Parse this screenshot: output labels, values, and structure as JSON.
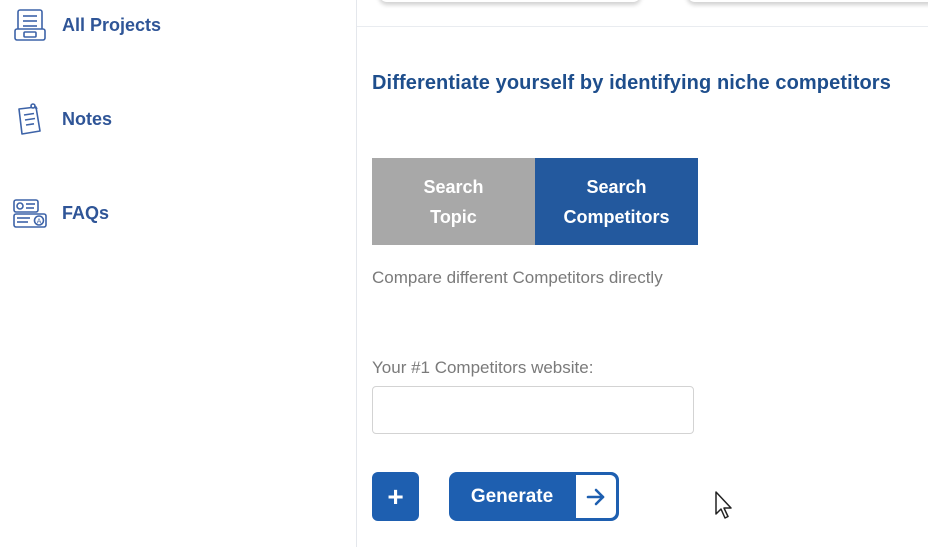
{
  "sidebar": {
    "items": [
      {
        "label": "All Projects",
        "icon": "projects-icon"
      },
      {
        "label": "Notes",
        "icon": "notes-icon"
      },
      {
        "label": "FAQs",
        "icon": "faq-icon"
      }
    ]
  },
  "main": {
    "heading": "Differentiate yourself by identifying niche competitors",
    "tabs": [
      {
        "line1": "Search",
        "line2": "Topic",
        "active": false
      },
      {
        "line1": "Search",
        "line2": "Competitors",
        "active": true
      }
    ],
    "description": "Compare different Competitors directly",
    "competitor_field": {
      "label": "Your #1 Competitors website:",
      "value": "",
      "placeholder": ""
    },
    "add_button_label": "+",
    "generate_button_label": "Generate",
    "generate_arrow_icon": "arrow-right-icon"
  },
  "colors": {
    "accent": "#1e5fb0",
    "active_tab": "#23599e",
    "inactive_tab": "#a8a8a8",
    "heading": "#1e4e8c",
    "nav_text": "#2f5597",
    "muted_text": "#7a7a7a"
  }
}
